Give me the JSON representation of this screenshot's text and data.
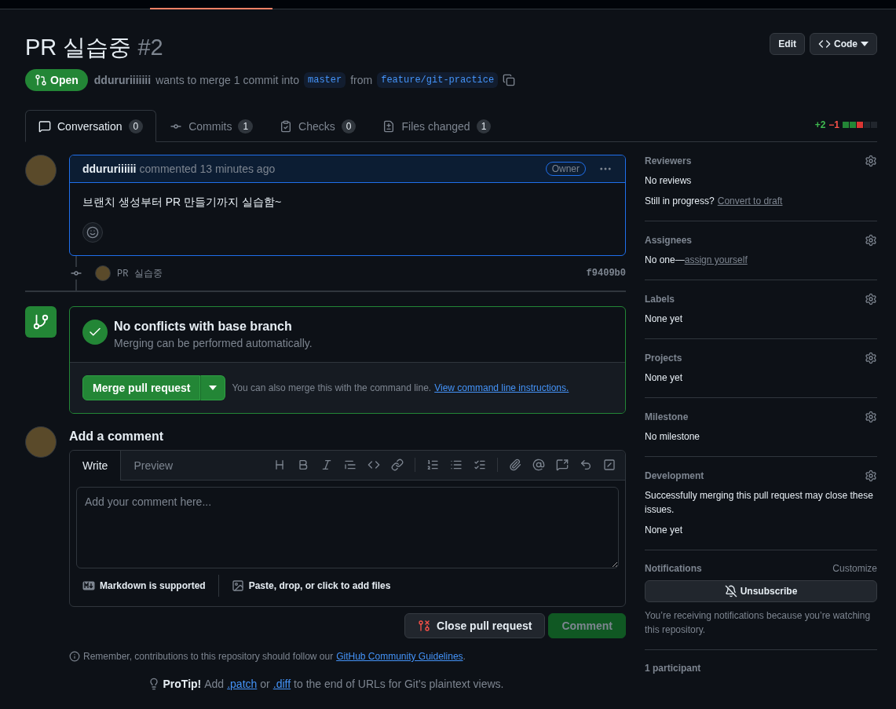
{
  "header": {
    "title": "PR 실습중",
    "number": "#2",
    "buttons": [
      {
        "label": "Edit",
        "kind": "plain"
      },
      {
        "label": "Code",
        "kind": "code"
      }
    ]
  },
  "status": {
    "state": "Open",
    "author": "ddururiiiiiii",
    "text": "wants to merge 1 commit into",
    "base": "master",
    "from": "from",
    "head": "feature/git-practice"
  },
  "tabs": [
    {
      "label": "Conversation",
      "count": "0",
      "selected": true,
      "kind": "conversation"
    },
    {
      "label": "Commits",
      "count": "1",
      "selected": false,
      "kind": "commits"
    },
    {
      "label": "Checks",
      "count": "0",
      "selected": false,
      "kind": "checks"
    },
    {
      "label": "Files changed",
      "count": "1",
      "selected": false,
      "kind": "files"
    }
  ],
  "diffstat": {
    "added": "+2",
    "removed": "−1",
    "blocks": [
      {
        "color": "#238636"
      },
      {
        "color": "#238636"
      },
      {
        "color": "#da3633"
      },
      {
        "color": "#21262d"
      },
      {
        "color": "#21262d"
      }
    ]
  },
  "comment": {
    "author": "ddururiiiiii",
    "meta": "commented 13 minutes ago",
    "role": "Owner",
    "body": "브랜치 생성부터 PR 만들기까지 실습함~"
  },
  "commit": {
    "message": "PR 실습중",
    "sha": "f9409b0"
  },
  "merge": {
    "title": "No conflicts with base branch",
    "subtitle": "Merging can be performed automatically.",
    "button": "Merge pull request",
    "hint": "You can also merge this with the command line.",
    "link": "View command line instructions."
  },
  "composer": {
    "heading": "Add a comment",
    "tabs": [
      {
        "label": "Write",
        "selected": true
      },
      {
        "label": "Preview",
        "selected": false
      }
    ],
    "placeholder": "Add your comment here...",
    "markdown": "Markdown is supported",
    "attach": "Paste, drop, or click to add files",
    "close_button": "Close pull request",
    "comment_button": "Comment",
    "comment_disabled": true
  },
  "guidelines": {
    "text": "Remember, contributions to this repository should follow our",
    "link": "GitHub Community Guidelines",
    "end": "."
  },
  "protip": {
    "label": "ProTip!",
    "before": "Add",
    "link1": ".patch",
    "middle": "or",
    "link2": ".diff",
    "after": "to the end of URLs for Git’s plaintext views."
  },
  "sidebar": [
    {
      "kind": "section",
      "title": "Reviewers",
      "lines": [
        {
          "text": "No reviews"
        },
        {
          "text": "Still in progress?",
          "link": "Convert to draft"
        }
      ]
    },
    {
      "kind": "section",
      "title": "Assignees",
      "lines": [
        {
          "text": "No one—",
          "link": "assign yourself"
        }
      ]
    },
    {
      "kind": "section",
      "title": "Labels",
      "lines": [
        {
          "text": "None yet"
        }
      ]
    },
    {
      "kind": "section",
      "title": "Projects",
      "lines": [
        {
          "text": "None yet"
        }
      ]
    },
    {
      "kind": "section",
      "title": "Milestone",
      "lines": [
        {
          "text": "No milestone"
        }
      ]
    },
    {
      "kind": "section",
      "title": "Development",
      "lines": [
        {
          "text": "Successfully merging this pull request may close these issues."
        },
        {
          "text": "None yet"
        }
      ]
    },
    {
      "kind": "notifications",
      "title": "Notifications",
      "action": "Customize",
      "button": "Unsubscribe",
      "note": "You’re receiving notifications because you’re watching this repository."
    },
    {
      "kind": "participants",
      "title": "1 participant"
    }
  ]
}
